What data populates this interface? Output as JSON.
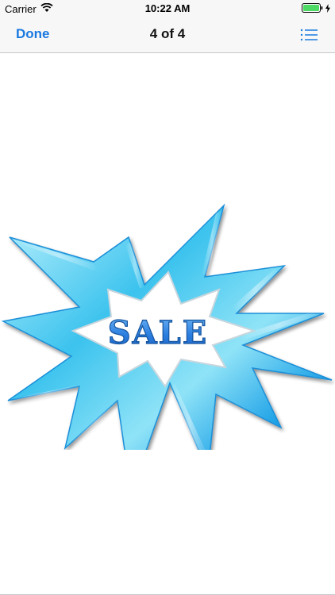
{
  "status_bar": {
    "carrier": "Carrier",
    "time": "10:22 AM"
  },
  "nav": {
    "done_label": "Done",
    "title": "4 of 4",
    "list_icon": "list-icon"
  },
  "sticker": {
    "text": "SALE",
    "icon": "sale-starburst",
    "colors": {
      "burst_light": "#8fe3f7",
      "burst_mid": "#3cc3ee",
      "burst_dark": "#1a72d6",
      "text": "#2b7fe0",
      "inner": "#ffffff"
    }
  },
  "colors": {
    "accent": "#1a7ae0",
    "battery": "#4cd964"
  }
}
